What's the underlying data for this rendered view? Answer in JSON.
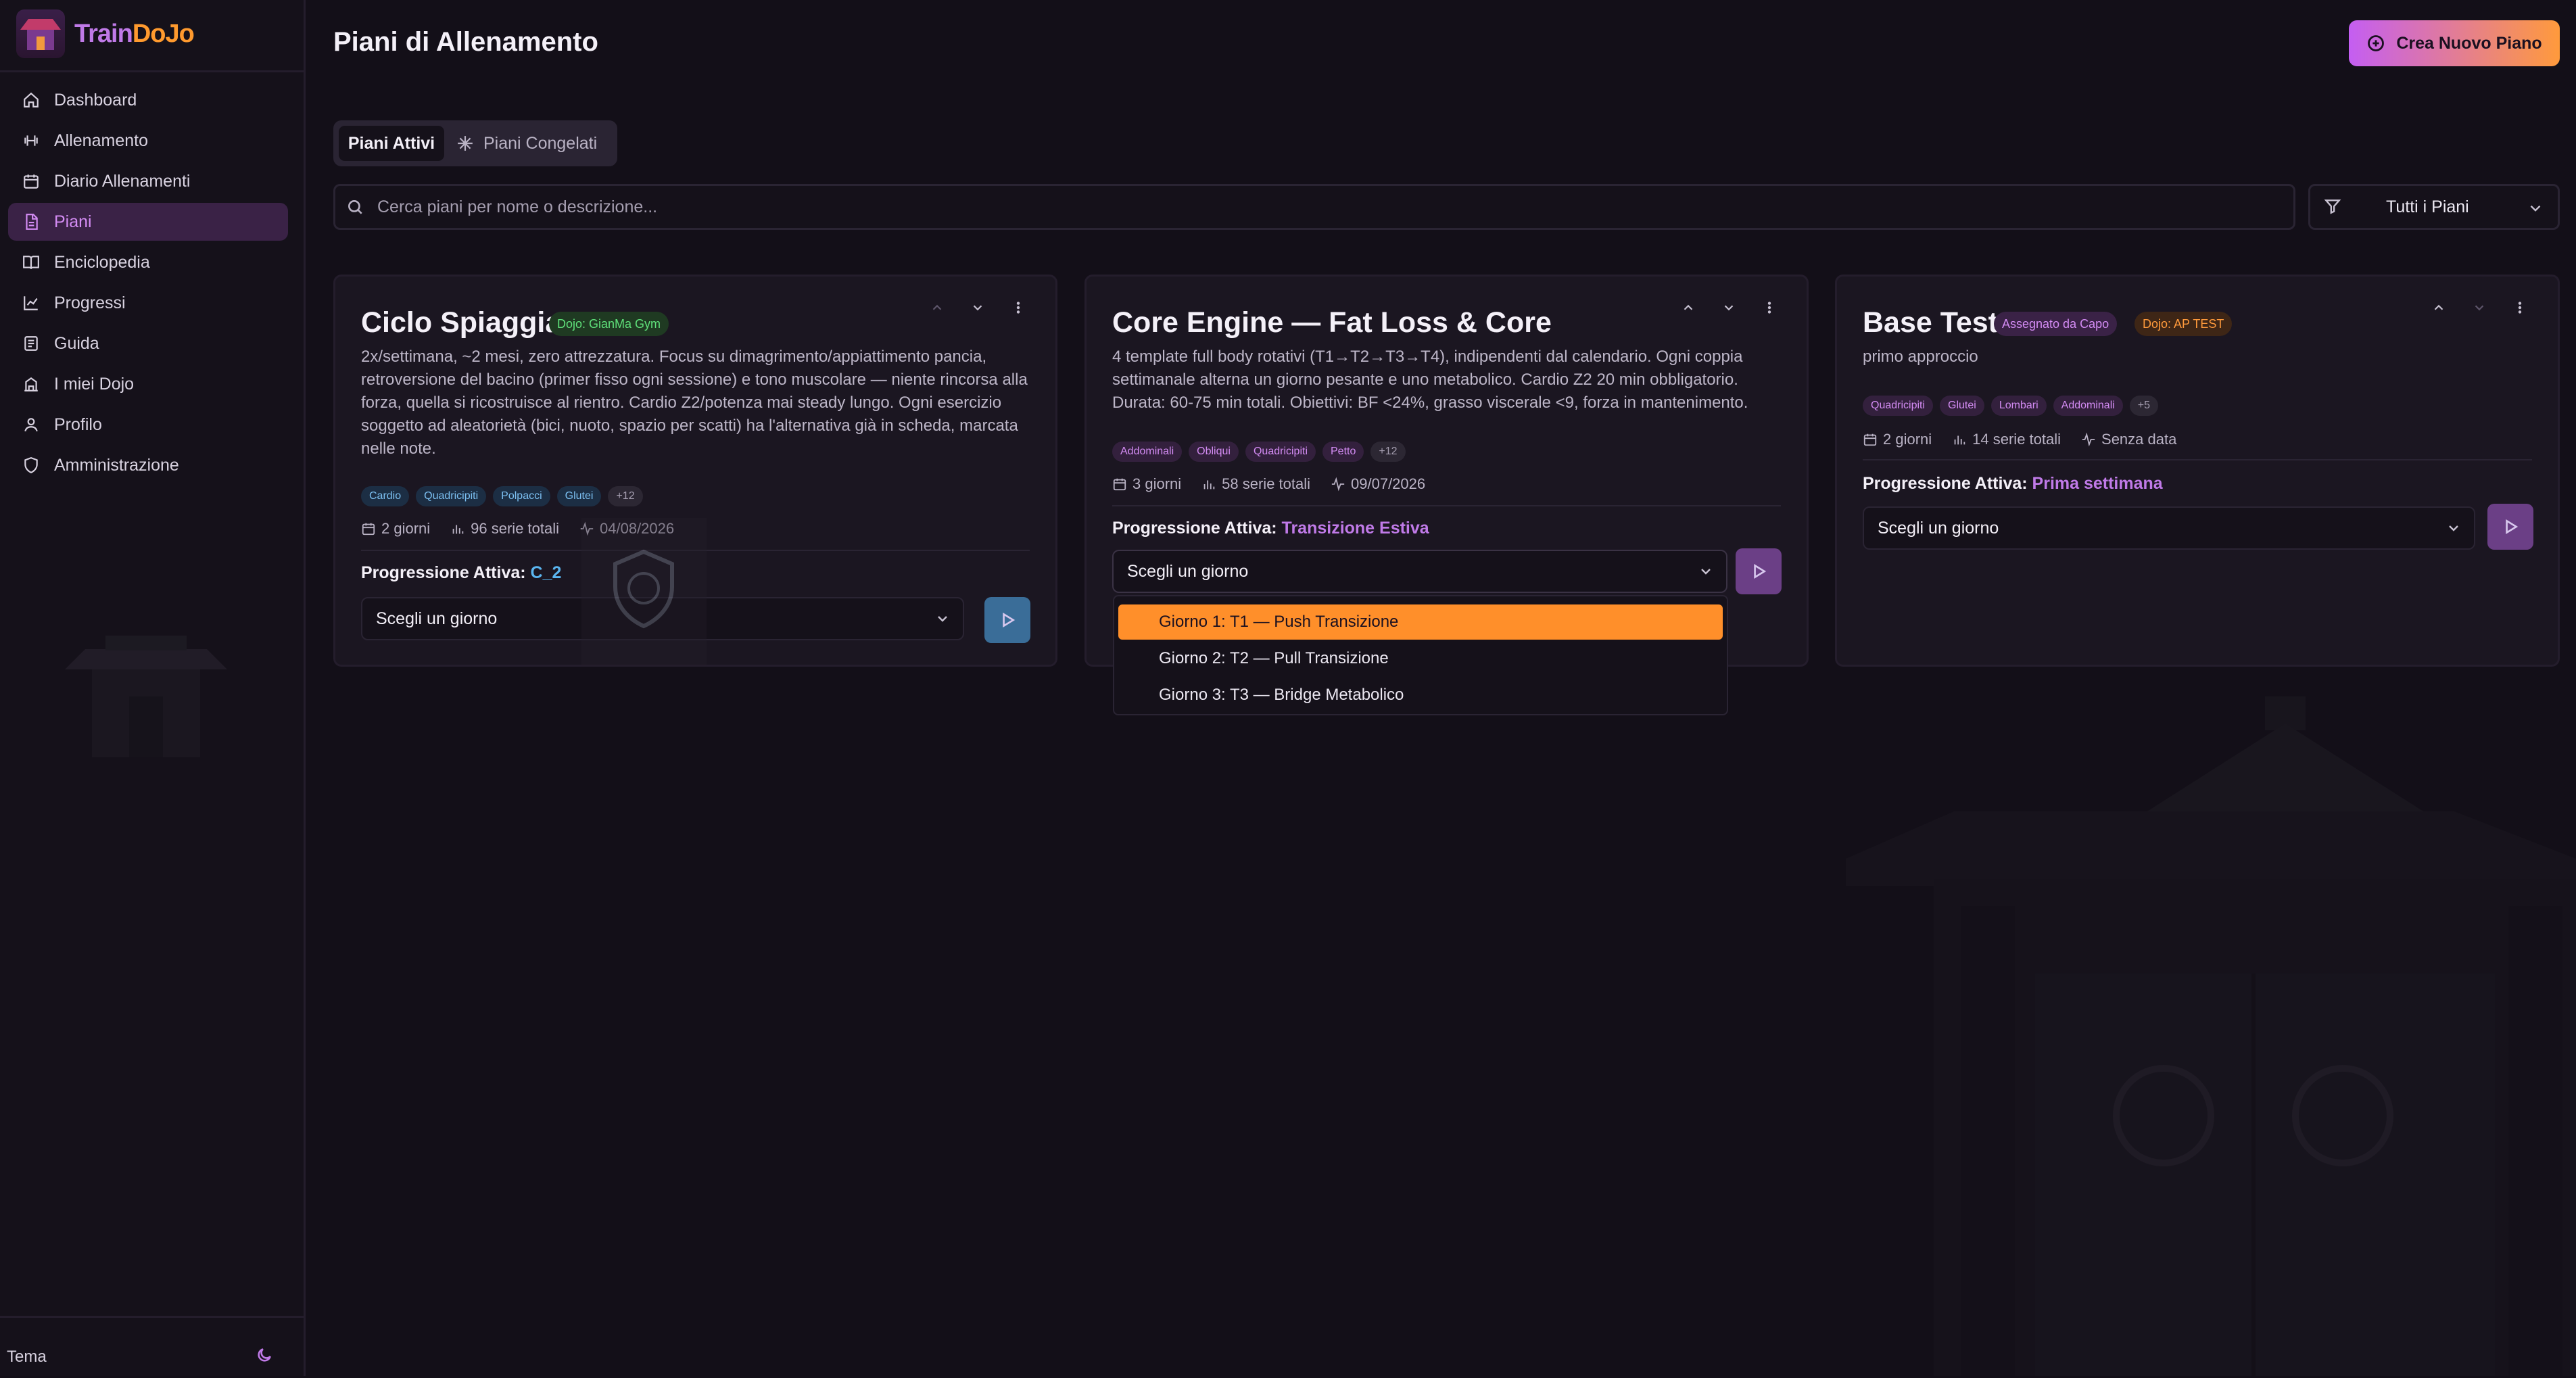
{
  "app": {
    "logo_part1": "Train",
    "logo_part2": "DoJo",
    "theme_label": "Tema"
  },
  "sidebar": {
    "items": [
      {
        "label": "Dashboard",
        "icon": "home-icon"
      },
      {
        "label": "Allenamento",
        "icon": "dumbbell-icon"
      },
      {
        "label": "Diario Allenamenti",
        "icon": "calendar-icon"
      },
      {
        "label": "Piani",
        "icon": "file-icon",
        "active": true
      },
      {
        "label": "Enciclopedia",
        "icon": "book-icon"
      },
      {
        "label": "Progressi",
        "icon": "chart-line-icon"
      },
      {
        "label": "Guida",
        "icon": "book-open-icon"
      },
      {
        "label": "I miei Dojo",
        "icon": "building-icon"
      },
      {
        "label": "Profilo",
        "icon": "user-icon"
      },
      {
        "label": "Amministrazione",
        "icon": "shield-icon"
      }
    ]
  },
  "header": {
    "title": "Piani di Allenamento",
    "create_label": "Crea Nuovo Piano"
  },
  "tabs": {
    "active": "Piani Attivi",
    "frozen": "Piani Congelati"
  },
  "search": {
    "placeholder": "Cerca piani per nome o descrizione...",
    "value": ""
  },
  "filter": {
    "selected": "Tutti i Piani"
  },
  "cards": [
    {
      "title": "Ciclo Spiaggia",
      "badges": [
        "Dojo: GianMa Gym"
      ],
      "description": "2x/settimana, ~2 mesi, zero attrezzatura. Focus su dimagrimento/appiattimento pancia, retroversione del bacino (primer fisso ogni sessione) e tono muscolare — niente rincorsa alla forza, quella si ricostruisce al rientro. Cardio Z2/potenza mai steady lungo. Ogni esercizio soggetto ad aleatorietà (bici, nuoto, spazio per scatti) ha l'alternativa già in scheda, marcata nelle note.",
      "tags": [
        "Cardio",
        "Quadricipiti",
        "Polpacci",
        "Glutei",
        "+12"
      ],
      "days": "2 giorni",
      "series": "96 serie totali",
      "date": "04/08/2026",
      "progression_label": "Progressione Attiva:",
      "progression_value": "C_2",
      "select_placeholder": "Scegli un giorno"
    },
    {
      "title": "Core Engine — Fat Loss & Core",
      "badges": [],
      "description": "4 template full body rotativi (T1→T2→T3→T4), indipendenti dal calendario. Ogni coppia settimanale alterna un giorno pesante e uno metabolico. Cardio Z2 20 min obbligatorio. Durata: 60-75 min totali. Obiettivi: BF <24%, grasso viscerale <9, forza in mantenimento.",
      "tags": [
        "Addominali",
        "Obliqui",
        "Quadricipiti",
        "Petto",
        "+12"
      ],
      "days": "3 giorni",
      "series": "58 serie totali",
      "date": "09/07/2026",
      "progression_label": "Progressione Attiva:",
      "progression_value": "Transizione Estiva",
      "select_placeholder": "Scegli un giorno"
    },
    {
      "title": "Base Test",
      "badges": [
        "Assegnato da Capo",
        "Dojo: AP TEST"
      ],
      "description": "primo approccio",
      "tags": [
        "Quadricipiti",
        "Glutei",
        "Lombari",
        "Addominali",
        "+5"
      ],
      "days": "2 giorni",
      "series": "14 serie totali",
      "date": "Senza data",
      "progression_label": "Progressione Attiva:",
      "progression_value": "Prima settimana",
      "select_placeholder": "Scegli un giorno"
    }
  ],
  "dropdown": {
    "options": [
      "Giorno 1: T1 — Push Transizione",
      "Giorno 2: T2 — Pull Transizione",
      "Giorno 3: T3 — Bridge Metabolico"
    ],
    "highlighted_index": 0
  },
  "colors": {
    "accent_purple": "#c07ae8",
    "accent_orange": "#ff9a3c",
    "background": "#130f18",
    "card": "#1b1621"
  }
}
